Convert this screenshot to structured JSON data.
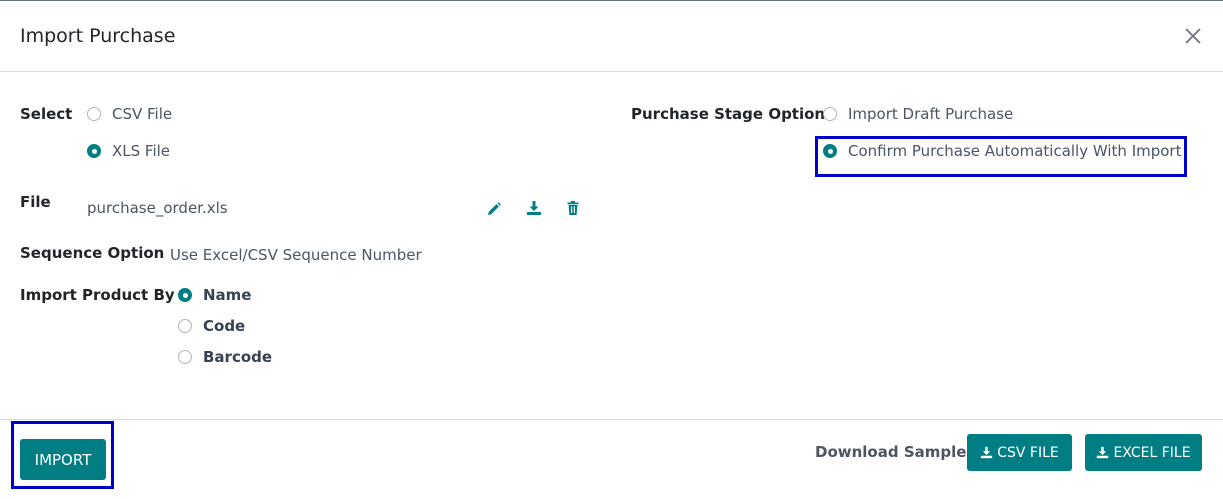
{
  "dialog": {
    "title": "Import Purchase"
  },
  "select": {
    "label": "Select",
    "options": [
      {
        "label": "CSV File",
        "checked": false
      },
      {
        "label": "XLS File",
        "checked": true
      }
    ]
  },
  "purchase_stage": {
    "label": "Purchase Stage Option",
    "options": [
      {
        "label": "Import Draft Purchase",
        "checked": false
      },
      {
        "label": "Confirm Purchase Automatically With Import",
        "checked": true
      }
    ]
  },
  "file": {
    "label": "File",
    "value": "purchase_order.xls"
  },
  "sequence": {
    "label": "Sequence Option",
    "value": "Use Excel/CSV Sequence Number"
  },
  "import_product_by": {
    "label": "Import Product By",
    "options": [
      {
        "label": "Name",
        "checked": true
      },
      {
        "label": "Code",
        "checked": false
      },
      {
        "label": "Barcode",
        "checked": false
      }
    ]
  },
  "footer": {
    "import_label": "IMPORT",
    "download_label": "Download Sample:",
    "csv_label": "CSV FILE",
    "excel_label": "EXCEL FILE"
  },
  "colors": {
    "accent": "#017e84",
    "highlight": "#0000cc"
  },
  "icons": [
    "close-icon",
    "pencil-icon",
    "download-icon",
    "trash-icon"
  ]
}
